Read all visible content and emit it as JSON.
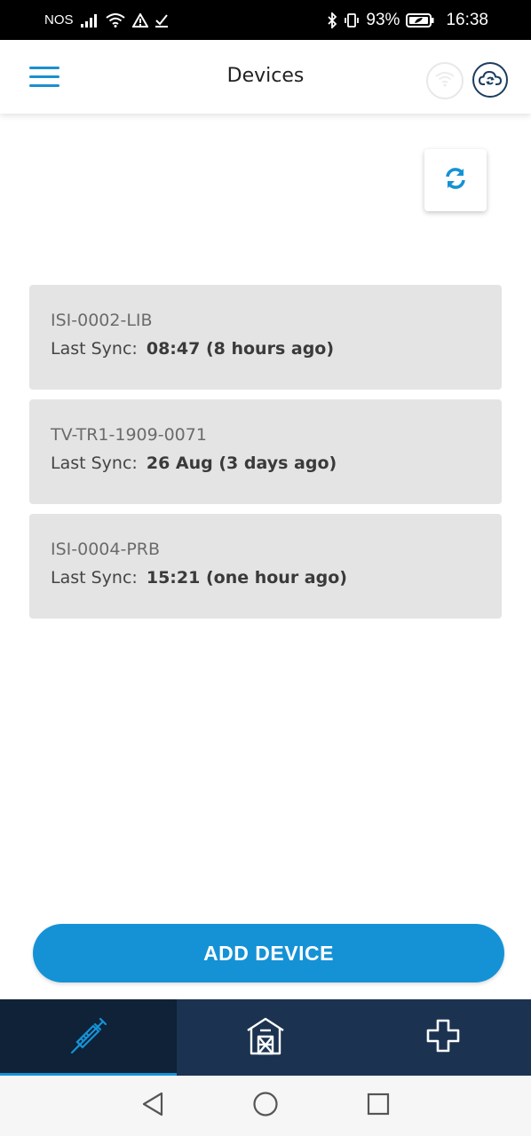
{
  "status_bar": {
    "carrier": "NOS",
    "battery": "93%",
    "time": "16:38"
  },
  "header": {
    "title": "Devices"
  },
  "devices": [
    {
      "name": "ISI-0002-LIB",
      "sync_label": "Last Sync:",
      "sync_value": "08:47 (8 hours ago)"
    },
    {
      "name": "TV-TR1-1909-0071",
      "sync_label": "Last Sync:",
      "sync_value": "26 Aug (3 days ago)"
    },
    {
      "name": "ISI-0004-PRB",
      "sync_label": "Last Sync:",
      "sync_value": "15:21 (one hour ago)"
    }
  ],
  "add_device_label": "ADD DEVICE",
  "tabs": [
    {
      "icon": "syringe-icon",
      "active": true
    },
    {
      "icon": "barn-icon",
      "active": false
    },
    {
      "icon": "medical-cross-icon",
      "active": false
    }
  ],
  "colors": {
    "accent": "#1592d6",
    "tab_bar": "#1b3350",
    "card_bg": "#e4e4e4"
  }
}
